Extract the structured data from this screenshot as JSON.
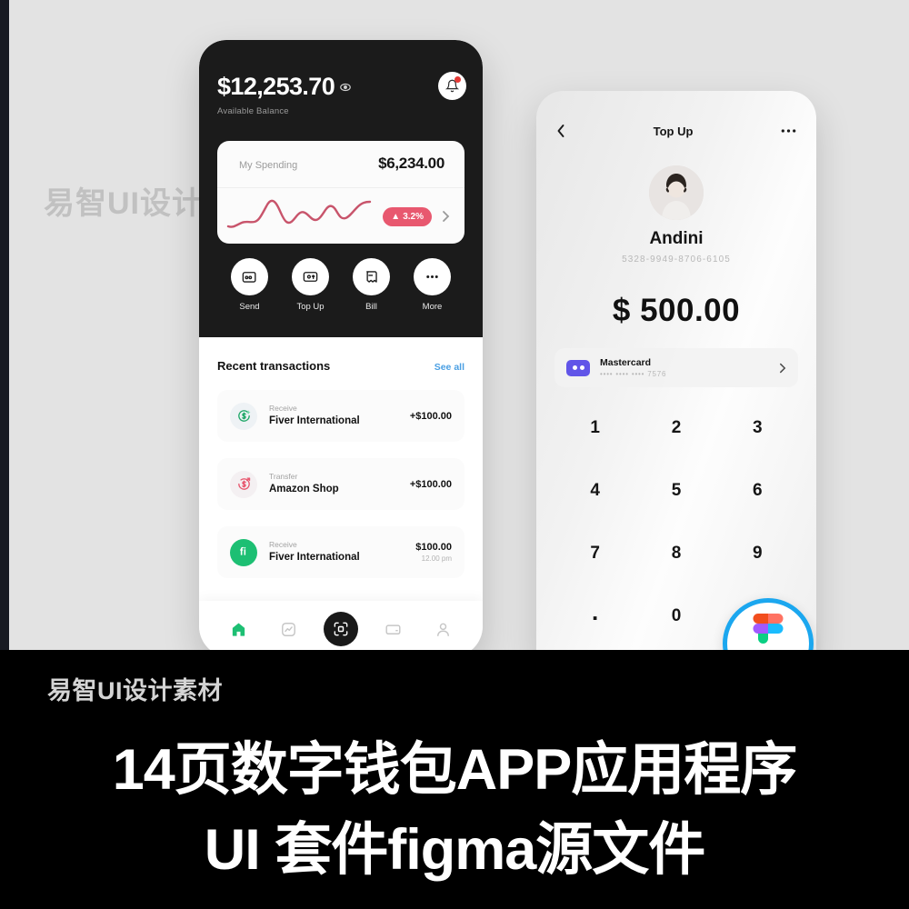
{
  "background": {
    "light": "#e3e3e3",
    "dark": "#000000"
  },
  "watermark": {
    "overlay_text": "易智UI设计素材",
    "banner_text": "易智UI设计素材"
  },
  "banner": {
    "line1": "14页数字钱包APP应用程序",
    "line2": "UI 套件figma源文件"
  },
  "figma_badge": {
    "name": "figma-logo",
    "ring_color": "#1ba7ef"
  },
  "phone1": {
    "balance": {
      "amount": "$12,253.70",
      "label": "Available Balance",
      "eye_icon": "eye-icon",
      "bell_icon": "bell-icon"
    },
    "spending_card": {
      "label": "My Spending",
      "amount": "$6,234.00",
      "percent": "3.2%",
      "trend_arrow": "▲",
      "badge_color": "#e8586f",
      "chevron": "›"
    },
    "actions": [
      {
        "label": "Send",
        "icon": "wallet-send-icon"
      },
      {
        "label": "Top Up",
        "icon": "card-topup-icon"
      },
      {
        "label": "Bill",
        "icon": "bill-receipt-icon"
      },
      {
        "label": "More",
        "icon": "ellipsis-icon"
      }
    ],
    "transactions_header": {
      "title": "Recent transactions",
      "see_all": "See all",
      "link_color": "#4a9fe3"
    },
    "transactions": [
      {
        "type": "Receive",
        "name": "Fiver International",
        "amount": "+$100.00",
        "time": "",
        "icon": "dollar-receive-icon",
        "icon_color": "#22a96a"
      },
      {
        "type": "Transfer",
        "name": "Amazon Shop",
        "amount": "+$100.00",
        "time": "",
        "icon": "dollar-transfer-icon",
        "icon_color": "#e8586f"
      },
      {
        "type": "Receive",
        "name": "Fiver International",
        "amount": "$100.00",
        "time": "12.00 pm",
        "icon": "fiverr-icon",
        "icon_color": "#1dbf73"
      }
    ],
    "nav": [
      {
        "name": "home",
        "icon": "home-icon",
        "active": true
      },
      {
        "name": "stats",
        "icon": "chart-icon",
        "active": false
      },
      {
        "name": "scan",
        "icon": "qr-scan-icon",
        "active": false
      },
      {
        "name": "cards",
        "icon": "card-icon",
        "active": false
      },
      {
        "name": "profile",
        "icon": "person-icon",
        "active": false
      }
    ]
  },
  "phone2": {
    "header": {
      "back_icon": "chevron-left-icon",
      "title": "Top Up",
      "menu_icon": "ellipsis-icon"
    },
    "profile": {
      "name": "Andini",
      "card_number": "5328-9949-8706-6105",
      "avatar": "user-avatar"
    },
    "amount": "$ 500.00",
    "payment_method": {
      "name": "Mastercard",
      "masked": "•••• •••• •••• 7576",
      "icon": "mastercard-icon",
      "chevron": "›"
    },
    "keypad": [
      "1",
      "2",
      "3",
      "4",
      "5",
      "6",
      "7",
      "8",
      "9",
      ".",
      "0",
      "⌫"
    ],
    "cta": {
      "label": "",
      "color": "#2ba360"
    }
  }
}
